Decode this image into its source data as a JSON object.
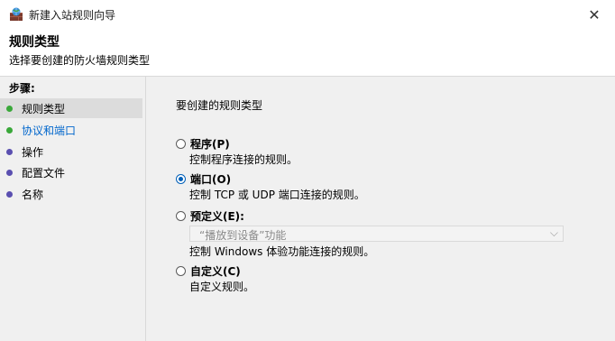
{
  "window": {
    "title": "新建入站规则向导",
    "close_glyph": "✕"
  },
  "header": {
    "title": "规则类型",
    "subtitle": "选择要创建的防火墙规则类型"
  },
  "sidebar": {
    "steps_label": "步骤:",
    "items": [
      {
        "label": "规则类型",
        "bullet_color": "#3aa83a",
        "active": true
      },
      {
        "label": "协议和端口",
        "bullet_color": "#3aa83a",
        "link": true
      },
      {
        "label": "操作",
        "bullet_color": "#5a4fb0"
      },
      {
        "label": "配置文件",
        "bullet_color": "#5a4fb0"
      },
      {
        "label": "名称",
        "bullet_color": "#5a4fb0"
      }
    ]
  },
  "main": {
    "prompt": "要创建的规则类型",
    "options": [
      {
        "label": "程序(P)",
        "description": "控制程序连接的规则。",
        "checked": false
      },
      {
        "label": "端口(O)",
        "description": "控制 TCP 或 UDP 端口连接的规则。",
        "checked": true
      },
      {
        "label": "预定义(E):",
        "description": "控制 Windows 体验功能连接的规则。",
        "checked": false
      },
      {
        "label": "自定义(C)",
        "description": "自定义规则。",
        "checked": false
      }
    ],
    "predefined_select": {
      "value": "“播放到设备”功能",
      "arrow": "⌵"
    }
  },
  "colors": {
    "accent": "#005fb8",
    "link": "#0066cc"
  }
}
